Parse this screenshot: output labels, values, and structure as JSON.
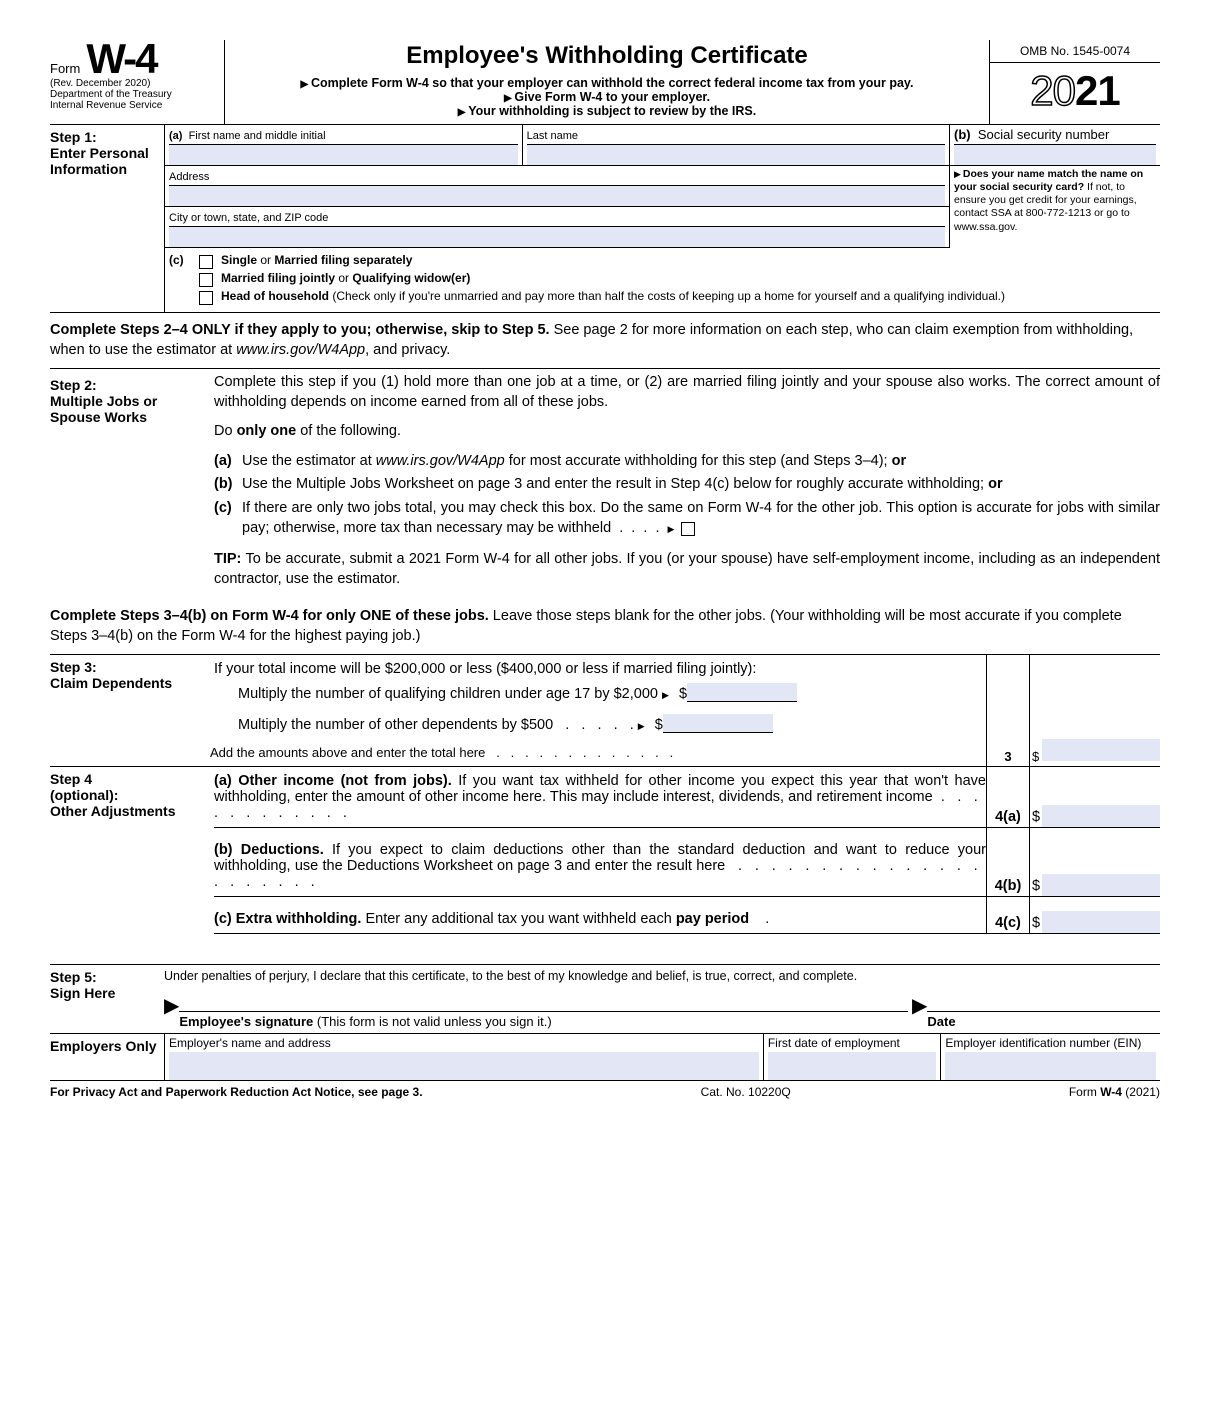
{
  "header": {
    "form_word": "Form",
    "form_number": "W-4",
    "revision": "(Rev. December 2020)",
    "dept1": "Department of the Treasury",
    "dept2": "Internal Revenue Service",
    "title": "Employee's Withholding Certificate",
    "line1": "Complete Form W-4 so that your employer can withhold the correct federal income tax from your pay.",
    "line2": "Give Form W-4 to your employer.",
    "line3": "Your withholding is subject to review by the IRS.",
    "omb": "OMB No. 1545-0074",
    "year_outline": "20",
    "year_bold": "21"
  },
  "step1": {
    "label": "Step 1:",
    "sub": "Enter Personal Information",
    "a_first": "First name and middle initial",
    "a_last": "Last name",
    "b_ssn": "Social security number",
    "address": "Address",
    "city": "City or town, state, and ZIP code",
    "name_match": "Does your name match the name on your social security card?",
    "name_match_rest": " If not, to ensure you get credit for your earnings, contact SSA at 800-772-1213 or go to www.ssa.gov.",
    "c_letter": "(c)",
    "c1": "Single or Married filing separately",
    "c2": "Married filing jointly or Qualifying widow(er)",
    "c3a": "Head of household",
    "c3b": " (Check only if you're unmarried and pay more than half the costs of keeping up a home for yourself and a qualifying individual.)"
  },
  "para1a": "Complete Steps 2–4 ONLY if they apply to you; otherwise, skip to Step 5.",
  "para1b": " See page 2 for more information on each step, who can claim exemption from withholding, when to use the estimator at ",
  "para1c": "www.irs.gov/W4App",
  "para1d": ", and privacy.",
  "step2": {
    "label": "Step 2:",
    "sub": "Multiple Jobs or Spouse Works",
    "intro": "Complete this step if you (1) hold more than one job at a time, or (2) are married filing jointly and your spouse also works. The correct amount of withholding depends on income earned from all of these jobs.",
    "do_one_a": "Do ",
    "do_one_b": "only one",
    "do_one_c": " of the following.",
    "opt_a_a": "Use the estimator at ",
    "opt_a_b": "www.irs.gov/W4App",
    "opt_a_c": " for most accurate withholding for this step (and Steps 3–4); ",
    "opt_a_or": "or",
    "opt_b": "Use the Multiple Jobs Worksheet on page 3 and enter the result in Step 4(c) below for roughly accurate withholding; ",
    "opt_b_or": "or",
    "opt_c": "If there are only two jobs total, you may check this box. Do the same on Form W-4 for the other job. This option is accurate for jobs with similar pay; otherwise, more tax than necessary may be withheld",
    "tip_label": "TIP:",
    "tip": " To be accurate, submit a 2021 Form W-4 for all other jobs. If you (or your spouse) have self-employment income, including as an independent contractor, use the estimator."
  },
  "para2a": "Complete Steps 3–4(b) on Form W-4 for only ONE of these jobs.",
  "para2b": " Leave those steps blank for the other jobs. (Your withholding will be most accurate if you complete Steps 3–4(b) on the Form W-4 for the highest paying job.)",
  "step3": {
    "label": "Step 3:",
    "sub": "Claim Dependents",
    "intro": "If your total income will be $200,000 or less ($400,000 or less if married filing jointly):",
    "l1": "Multiply the number of qualifying children under age 17 by $2,000",
    "l2": "Multiply the number of other dependents by $500",
    "total": "Add the amounts above and enter the total here",
    "num": "3"
  },
  "step4": {
    "label": "Step 4 (optional):",
    "sub": "Other Adjustments",
    "a_lbl": "(a)",
    "a_bold": "Other income (not from jobs).",
    "a_txt": " If you want tax withheld for other income you expect this year that won't have withholding, enter the amount of other income here. This may include interest, dividends, and retirement income",
    "a_num": "4(a)",
    "b_lbl": "(b)",
    "b_bold": "Deductions.",
    "b_txt": " If you expect to claim deductions other than the standard deduction and want to reduce your withholding, use the Deductions Worksheet on page 3 and enter the result here",
    "b_num": "4(b)",
    "c_lbl": "(c)",
    "c_bold": "Extra withholding.",
    "c_txt": " Enter any additional tax you want withheld each ",
    "c_bold2": "pay period",
    "c_num": "4(c)"
  },
  "step5": {
    "label": "Step 5:",
    "sub": "Sign Here",
    "decl": "Under penalties of perjury, I declare that this certificate, to the best of my knowledge and belief, is true, correct, and complete.",
    "sig_a": "Employee's signature",
    "sig_b": " (This form is not valid unless you sign it.)",
    "date": "Date"
  },
  "employers": {
    "label": "Employers Only",
    "name_addr": "Employer's name and address",
    "first_date": "First date of employment",
    "ein": "Employer identification number (EIN)"
  },
  "footer": {
    "left": "For Privacy Act and Paperwork Reduction Act Notice, see page 3.",
    "center": "Cat. No. 10220Q",
    "right_a": "Form ",
    "right_b": "W-4",
    "right_c": " (2021)"
  }
}
